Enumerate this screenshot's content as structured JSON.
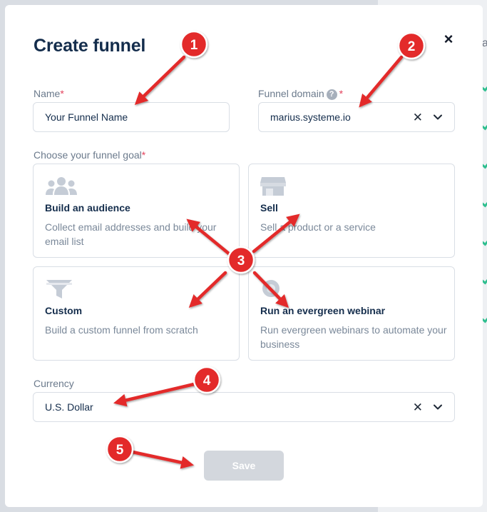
{
  "background": {
    "partial_text": "a"
  },
  "modal": {
    "title": "Create funnel",
    "name_label": "Name",
    "required_mark": "*",
    "name_placeholder": "Your Funnel Name",
    "domain_label": "Funnel domain",
    "domain_help": "?",
    "domain_value": "marius.systeme.io",
    "goal_label": "Choose your funnel goal",
    "goals": [
      {
        "title": "Build an audience",
        "description": "Collect email addresses and build your email list",
        "icon": "people-icon"
      },
      {
        "title": "Sell",
        "description": "Sell a product or a service",
        "icon": "storefront-icon"
      },
      {
        "title": "Custom",
        "description": "Build a custom funnel from scratch",
        "icon": "funnel-icon"
      },
      {
        "title": "Run an evergreen webinar",
        "description": "Run evergreen webinars to automate your business",
        "icon": "webinar-icon"
      }
    ],
    "currency_label": "Currency",
    "currency_value": "U.S. Dollar",
    "clear_glyph": "✕",
    "close_glyph": "×",
    "save_label": "Save"
  },
  "annotations": {
    "badges": [
      "1",
      "2",
      "3",
      "4",
      "5"
    ],
    "color": "#e32b2b"
  },
  "colors": {
    "primary_text": "#142d4c",
    "muted_text": "#7a8899",
    "border": "#d9dee5",
    "required": "#e3425c",
    "disabled_button": "#d3d7dd"
  }
}
